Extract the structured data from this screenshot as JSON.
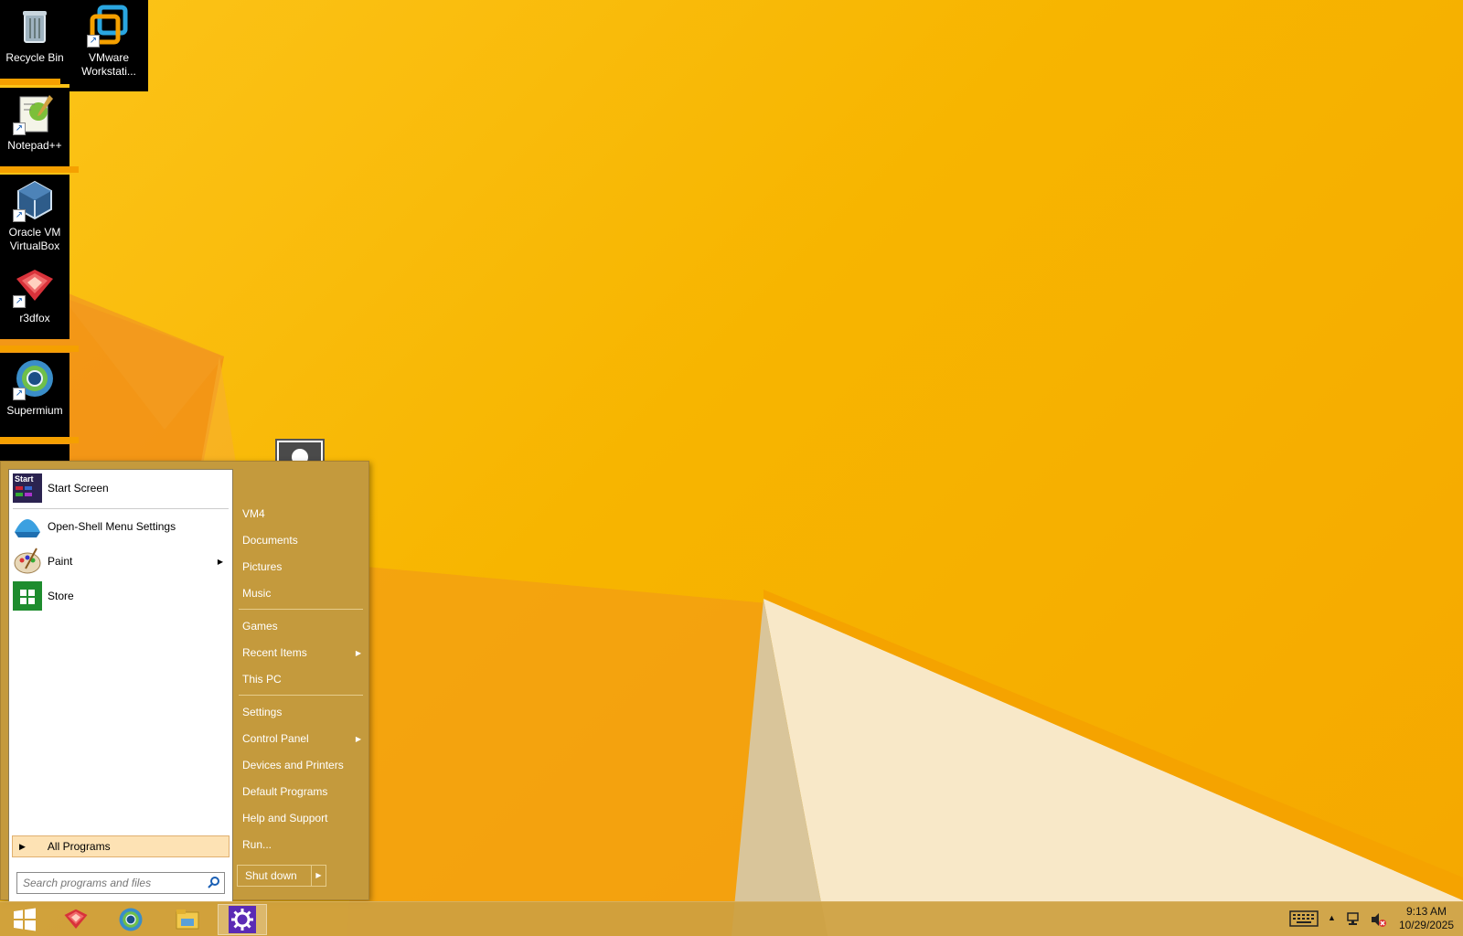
{
  "desktop": {
    "icons": [
      {
        "label": "Recycle Bin",
        "icon": "recycle-bin-icon"
      },
      {
        "label": "VMware Workstati...",
        "icon": "vmware-icon"
      },
      {
        "label": "Notepad++",
        "icon": "notepad-plus-plus-icon"
      },
      {
        "label": "Oracle VM VirtualBox",
        "icon": "virtualbox-icon"
      },
      {
        "label": "r3dfox",
        "icon": "r3dfox-icon"
      },
      {
        "label": "Supermium",
        "icon": "supermium-icon"
      }
    ]
  },
  "start_menu": {
    "programs": [
      {
        "label": "Start Screen",
        "icon_text": "Start",
        "icon": "start-screen-icon"
      },
      {
        "label": "Open-Shell Menu Settings",
        "icon": "open-shell-icon"
      },
      {
        "label": "Paint",
        "icon": "paint-icon",
        "has_submenu": true
      },
      {
        "label": "Store",
        "icon": "store-icon"
      }
    ],
    "all_programs": "All Programs",
    "search_placeholder": "Search programs and files",
    "places": [
      {
        "label": "VM4"
      },
      {
        "label": "Documents"
      },
      {
        "label": "Pictures"
      },
      {
        "label": "Music"
      },
      {
        "label": "Games"
      },
      {
        "label": "Recent Items",
        "has_submenu": true
      },
      {
        "label": "This PC"
      },
      {
        "label": "Settings"
      },
      {
        "label": "Control Panel",
        "has_submenu": true
      },
      {
        "label": "Devices and Printers"
      },
      {
        "label": "Default Programs"
      },
      {
        "label": "Help and Support"
      },
      {
        "label": "Run..."
      }
    ],
    "shutdown_label": "Shut down"
  },
  "taskbar": {
    "buttons": [
      {
        "icon": "windows-start-icon"
      },
      {
        "icon": "r3dfox-icon"
      },
      {
        "icon": "supermium-icon"
      },
      {
        "icon": "file-explorer-icon"
      },
      {
        "icon": "open-shell-settings-icon"
      }
    ],
    "tray": {
      "time": "9:13 AM",
      "date": "10/29/2025"
    }
  },
  "colors": {
    "menu_bg": "#c49a3d",
    "wallpaper": "#f7b500",
    "all_programs_highlight": "#fde2b4"
  }
}
